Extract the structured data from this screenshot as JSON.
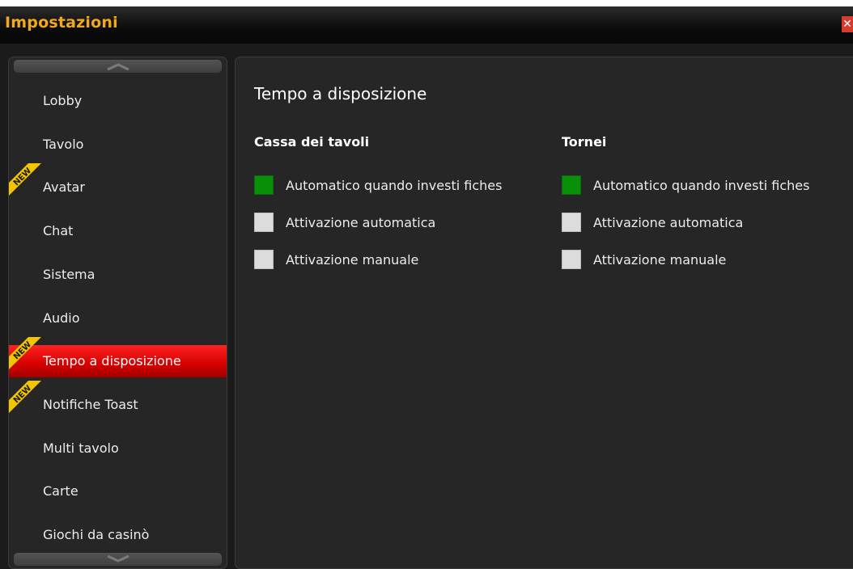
{
  "window": {
    "title": "Impostazioni",
    "close_icon": "close-icon"
  },
  "sidebar": {
    "items": [
      {
        "label": "Lobby",
        "new": false,
        "selected": false
      },
      {
        "label": "Tavolo",
        "new": false,
        "selected": false
      },
      {
        "label": "Avatar",
        "new": true,
        "selected": false
      },
      {
        "label": "Chat",
        "new": false,
        "selected": false
      },
      {
        "label": "Sistema",
        "new": false,
        "selected": false
      },
      {
        "label": "Audio",
        "new": false,
        "selected": false
      },
      {
        "label": "Tempo a disposizione",
        "new": true,
        "selected": true
      },
      {
        "label": "Notifiche Toast",
        "new": true,
        "selected": false
      },
      {
        "label": "Multi tavolo",
        "new": false,
        "selected": false
      },
      {
        "label": "Carte",
        "new": false,
        "selected": false
      },
      {
        "label": "Giochi da casinò",
        "new": false,
        "selected": false
      }
    ],
    "badge_text": "NEW"
  },
  "main": {
    "title": "Tempo a disposizione",
    "columns": [
      {
        "title": "Cassa dei tavoli",
        "options": [
          {
            "label": "Automatico quando investi fiches",
            "checked": true
          },
          {
            "label": "Attivazione automatica",
            "checked": false
          },
          {
            "label": "Attivazione manuale",
            "checked": false
          }
        ]
      },
      {
        "title": "Tornei",
        "options": [
          {
            "label": "Automatico quando investi fiches",
            "checked": true
          },
          {
            "label": "Attivazione automatica",
            "checked": false
          },
          {
            "label": "Attivazione manuale",
            "checked": false
          }
        ]
      }
    ]
  },
  "colors": {
    "accent_orange": "#f2a81c",
    "selected_red": "#e00000",
    "checked_green": "#089008",
    "badge_yellow": "#f2c500"
  }
}
